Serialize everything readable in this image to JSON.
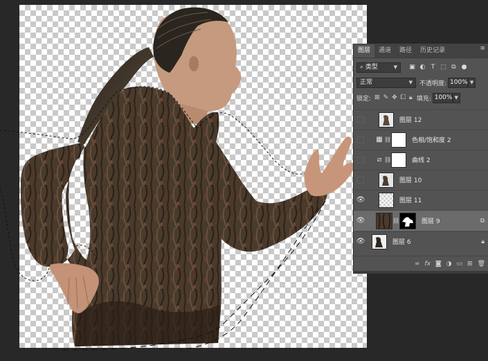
{
  "canvas": {
    "selection_state": "marching-ants-selection"
  },
  "layers_panel": {
    "tabs": [
      {
        "label": "图层",
        "active": true
      },
      {
        "label": "通道",
        "active": false
      },
      {
        "label": "路径",
        "active": false
      },
      {
        "label": "历史记录",
        "active": false
      }
    ],
    "filter": {
      "kind_label": "类型",
      "icons": [
        "image-filter-icon",
        "adjustment-filter-icon",
        "type-filter-icon",
        "shape-filter-icon",
        "smart-object-filter-icon"
      ]
    },
    "blend_mode": "正常",
    "opacity_label": "不透明度:",
    "opacity_value": "100%",
    "lock_label": "锁定:",
    "fill_label": "填充:",
    "fill_value": "100%",
    "layers": [
      {
        "name": "图层 12",
        "visible": false,
        "kind": "pixel",
        "thumb": "photo"
      },
      {
        "name": "色相/饱和度 2",
        "visible": false,
        "kind": "adjustment-hue",
        "thumb": "mask-white"
      },
      {
        "name": "曲线 2",
        "visible": false,
        "kind": "adjustment-curves",
        "thumb": "mask-white"
      },
      {
        "name": "图层 10",
        "visible": false,
        "kind": "pixel",
        "thumb": "photo"
      },
      {
        "name": "图层 11",
        "visible": true,
        "kind": "pixel",
        "thumb": "transparent"
      },
      {
        "name": "图层 9",
        "visible": true,
        "kind": "pixel-masked",
        "thumb": "bark",
        "selected": true
      },
      {
        "name": "图层 6",
        "visible": true,
        "kind": "pixel",
        "thumb": "photo-dark",
        "locked": true
      }
    ],
    "footer_icons": [
      "link-layers-icon",
      "fx-icon",
      "add-mask-icon",
      "new-adjustment-icon",
      "new-group-icon",
      "new-layer-icon",
      "delete-layer-icon"
    ]
  },
  "colors": {
    "panel_bg": "#535353",
    "selected_row": "#6b6b6b",
    "workspace": "#282828"
  }
}
